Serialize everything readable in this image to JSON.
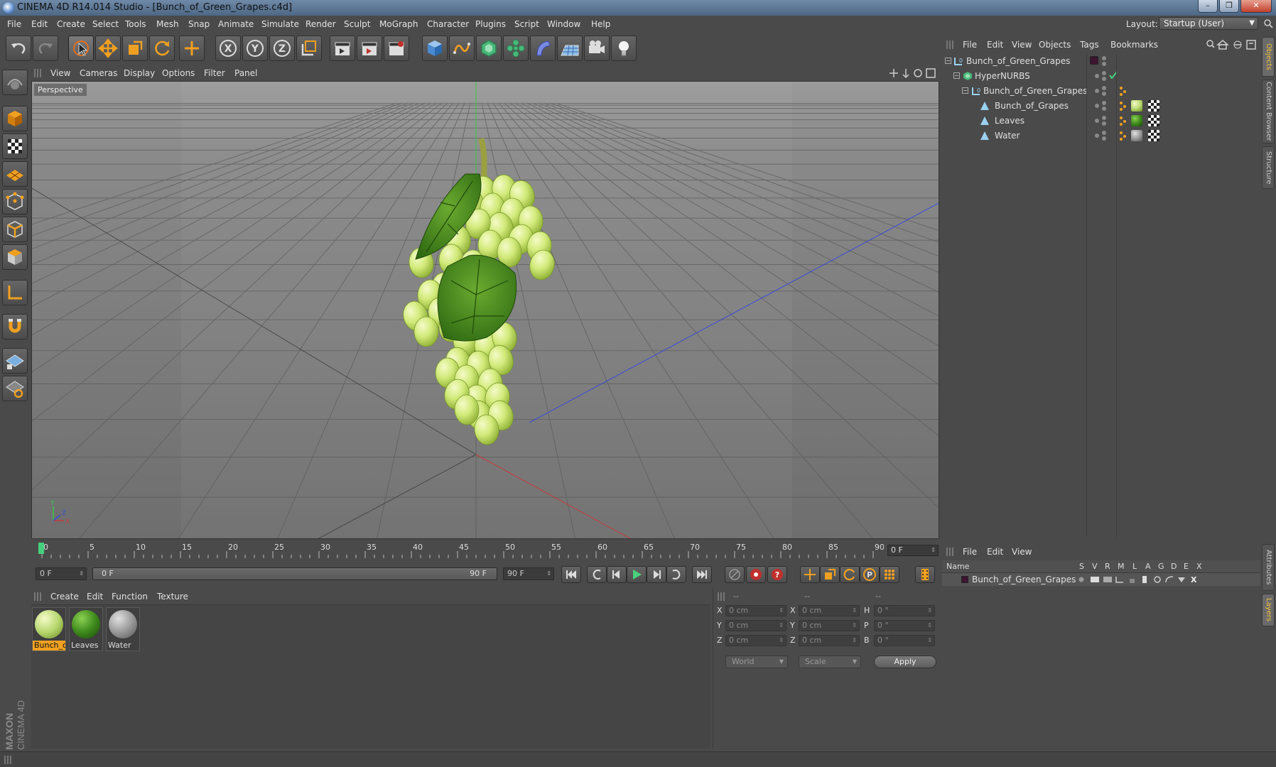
{
  "window": {
    "title": "CINEMA 4D R14.014 Studio - [Bunch_of_Green_Grapes.c4d]",
    "minimize": "–",
    "maximize": "❐",
    "close": "✕"
  },
  "menubar": {
    "items": [
      "File",
      "Edit",
      "Create",
      "Select",
      "Tools",
      "Mesh",
      "Snap",
      "Animate",
      "Simulate",
      "Render",
      "Sculpt",
      "MoGraph",
      "Character",
      "Plugins",
      "Script",
      "Window",
      "Help"
    ],
    "layout_label": "Layout:",
    "layout_value": "Startup (User)"
  },
  "viewport": {
    "menu": [
      "View",
      "Cameras",
      "Display",
      "Options",
      "Filter",
      "Panel"
    ],
    "label": "Perspective",
    "axis_x": "X",
    "axis_y": "Y",
    "axis_z": "Z"
  },
  "timeline": {
    "ticks": [
      "0",
      "5",
      "10",
      "15",
      "20",
      "25",
      "30",
      "35",
      "40",
      "45",
      "50",
      "55",
      "60",
      "65",
      "70",
      "75",
      "80",
      "85",
      "90"
    ],
    "current_frame": "0 F"
  },
  "transport": {
    "start_field": "0 F",
    "range_start": "0 F",
    "range_end": "90 F",
    "end_field": "90 F"
  },
  "materials": {
    "menu": [
      "Create",
      "Edit",
      "Function",
      "Texture"
    ],
    "items": [
      {
        "name": "Bunch_o",
        "color": "#b8d870"
      },
      {
        "name": "Leaves",
        "color": "#3f8a1e"
      },
      {
        "name": "Water",
        "color": "#9a9a9a"
      }
    ]
  },
  "coordinates": {
    "dashes": [
      "--",
      "--",
      "--"
    ],
    "rows": [
      {
        "pos_label": "X",
        "pos": "0 cm",
        "size_label": "X",
        "size": "0 cm",
        "rot_label": "H",
        "rot": "0 °"
      },
      {
        "pos_label": "Y",
        "pos": "0 cm",
        "size_label": "Y",
        "size": "0 cm",
        "rot_label": "P",
        "rot": "0 °"
      },
      {
        "pos_label": "Z",
        "pos": "0 cm",
        "size_label": "Z",
        "size": "0 cm",
        "rot_label": "B",
        "rot": "0 °"
      }
    ],
    "space": "World",
    "mode": "Scale",
    "apply": "Apply"
  },
  "object_manager": {
    "menu": [
      "File",
      "Edit",
      "View",
      "Objects",
      "Tags",
      "Bookmarks"
    ],
    "objects": [
      {
        "name": "Bunch_of_Green_Grapes",
        "type": "null"
      },
      {
        "name": "HyperNURBS",
        "type": "hypernurbs"
      },
      {
        "name": "Bunch_of_Green_Grapes",
        "type": "null"
      },
      {
        "name": "Bunch_of_Grapes",
        "type": "polygon"
      },
      {
        "name": "Leaves",
        "type": "polygon"
      },
      {
        "name": "Water",
        "type": "polygon"
      }
    ]
  },
  "layer_manager": {
    "menu": [
      "File",
      "Edit",
      "View"
    ],
    "columns": [
      "Name",
      "S",
      "V",
      "R",
      "M",
      "L",
      "A",
      "G",
      "D",
      "E",
      "X"
    ],
    "layers": [
      {
        "name": "Bunch_of_Green_Grapes",
        "color": "#3d1530"
      }
    ]
  },
  "right_tabs": [
    "Objects",
    "Content Browser",
    "Structure",
    "Attributes",
    "Layers"
  ],
  "brand": {
    "line1": "MAXON",
    "line2": "CINEMA 4D"
  },
  "colors": {
    "accent": "#f0a020",
    "axis_x": "#c83a3a",
    "axis_y": "#3ac84a",
    "axis_z": "#3a4ad8"
  }
}
